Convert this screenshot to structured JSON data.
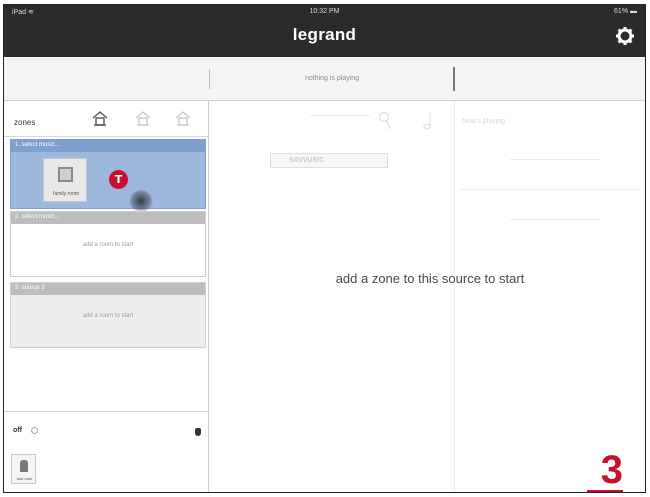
{
  "status": {
    "left": "iPad ≋",
    "time": "10:32 PM",
    "battery": "61% ▬"
  },
  "app": {
    "title": "legrand",
    "settings_icon": "gear-icon"
  },
  "nowbar": {
    "playing_text": "nothing is playing"
  },
  "zones": {
    "title": "zones",
    "house_icons": [
      "house-icon",
      "house-icon",
      "house-icon"
    ],
    "groups": [
      {
        "header": "1. select music...",
        "tile_label": "family room",
        "badge": "T"
      },
      {
        "header": "2. select music...",
        "empty_text": "add a room to start"
      },
      {
        "header": "3. source 3",
        "empty_text": "add a room to start"
      }
    ],
    "footer": {
      "off_label": "off",
      "user_label": "add user"
    }
  },
  "main": {
    "message": "add a zone to this source to start",
    "faded_search_label": "SAVVUSIC",
    "faded_tab_label": "Now's playing"
  },
  "step_number": "3",
  "colors": {
    "brand_red": "#c8102e",
    "titlebar": "#2b2b2b",
    "selected_group": "#9db7dd"
  }
}
